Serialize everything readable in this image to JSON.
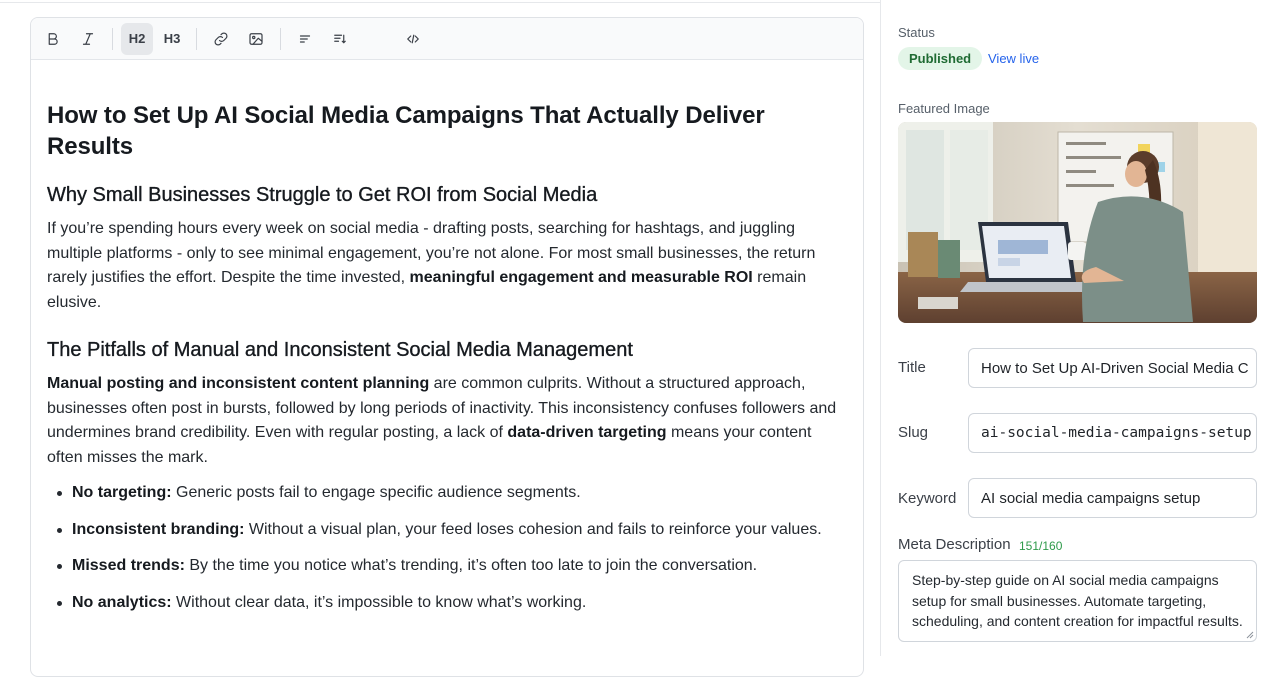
{
  "toolbar": {
    "bold_icon": "bold-icon",
    "italic_icon": "italic-icon",
    "h2": "H2",
    "h3": "H3",
    "link_icon": "link-icon",
    "image_icon": "image-icon",
    "align_icon": "align-left-icon",
    "list_icon": "ordered-list-icon",
    "code_icon": "code-icon"
  },
  "article": {
    "title": "How to Set Up AI Social Media Campaigns That Actually Deliver Results",
    "section1": {
      "heading": "Why Small Businesses Struggle to Get ROI from Social Media",
      "p_a": "If you’re spending hours every week on social media - drafting posts, searching for hashtags, and juggling multiple platforms - only to see minimal engagement, you’re not alone. For most small businesses, the return rarely justifies the effort. Despite the time invested, ",
      "p_bold": "meaningful engagement and measurable ROI",
      "p_b": " remain elusive."
    },
    "section2": {
      "heading": "The Pitfalls of Manual and Inconsistent Social Media Management",
      "p_bold1": "Manual posting and inconsistent content planning",
      "p_a": " are common culprits. Without a structured approach, businesses often post in bursts, followed by long periods of inactivity. This inconsistency confuses followers and undermines brand credibility. Even with regular posting, a lack of ",
      "p_bold2": "data-driven targeting",
      "p_b": " means your content often misses the mark.",
      "bullets": [
        {
          "bold": "No targeting:",
          "text": " Generic posts fail to engage specific audience segments."
        },
        {
          "bold": "Inconsistent branding:",
          "text": " Without a visual plan, your feed loses cohesion and fails to reinforce your values."
        },
        {
          "bold": "Missed trends:",
          "text": " By the time you notice what’s trending, it’s often too late to join the conversation."
        },
        {
          "bold": "No analytics:",
          "text": " Without clear data, it’s impossible to know what’s working."
        }
      ]
    }
  },
  "sidebar": {
    "status_label": "Status",
    "status_value": "Published",
    "view_live": "View live",
    "featured_label": "Featured Image",
    "title_label": "Title",
    "title_value": "How to Set Up AI-Driven Social Media C",
    "slug_label": "Slug",
    "slug_value": "ai-social-media-campaigns-setup",
    "keyword_label": "Keyword",
    "keyword_value": "AI social media campaigns setup",
    "meta_label": "Meta Description",
    "meta_count": "151/160",
    "meta_value": "Step-by-step guide on AI social media campaigns setup for small businesses. Automate targeting, scheduling, and content creation for impactful results."
  },
  "colors": {
    "badge_bg": "#e3f5e8",
    "badge_text": "#1f6b33",
    "link": "#2563eb",
    "counter": "#2e9a4a"
  }
}
